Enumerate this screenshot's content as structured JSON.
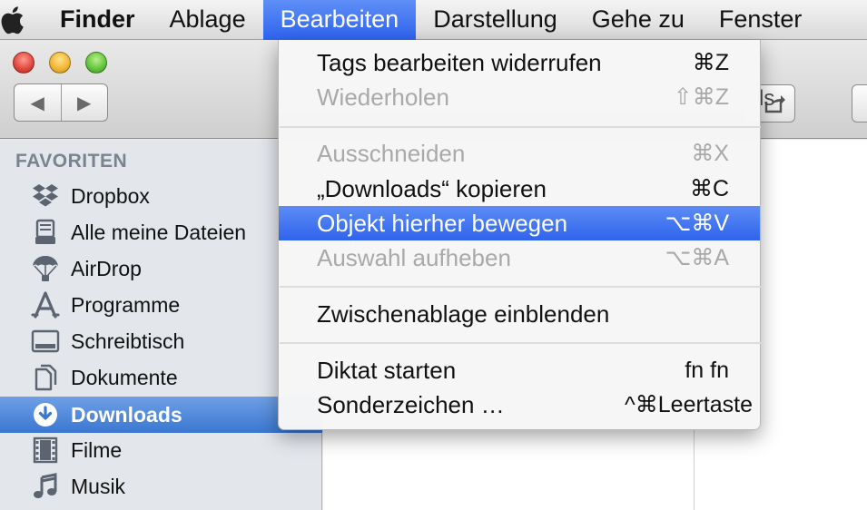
{
  "menubar": {
    "apple_icon": "apple-logo-icon",
    "items": [
      "Finder",
      "Ablage",
      "Bearbeiten",
      "Darstellung",
      "Gehe zu",
      "Fenster"
    ]
  },
  "window": {
    "title_fragment": "ls",
    "nav_back_icon": "◀",
    "nav_forward_icon": "▶"
  },
  "sidebar": {
    "heading": "FAVORITEN",
    "items": [
      {
        "label": "Dropbox",
        "icon": "dropbox-icon"
      },
      {
        "label": "Alle meine Dateien",
        "icon": "all-files-icon"
      },
      {
        "label": "AirDrop",
        "icon": "airdrop-icon"
      },
      {
        "label": "Programme",
        "icon": "applications-icon"
      },
      {
        "label": "Schreibtisch",
        "icon": "desktop-icon"
      },
      {
        "label": "Dokumente",
        "icon": "documents-icon"
      },
      {
        "label": "Downloads",
        "icon": "downloads-icon",
        "selected": true
      },
      {
        "label": "Filme",
        "icon": "movies-icon"
      },
      {
        "label": "Musik",
        "icon": "music-icon"
      }
    ]
  },
  "edit_menu": {
    "items": [
      {
        "label": "Tags bearbeiten widerrufen",
        "shortcut": "⌘Z",
        "enabled": true
      },
      {
        "label": "Wiederholen",
        "shortcut": "⇧⌘Z",
        "enabled": false
      },
      {
        "label": "Ausschneiden",
        "shortcut": "⌘X",
        "enabled": false
      },
      {
        "label": "„Downloads“ kopieren",
        "shortcut": "⌘C",
        "enabled": true
      },
      {
        "label": "Objekt hierher bewegen",
        "shortcut": "⌥⌘V",
        "enabled": true,
        "highlighted": true
      },
      {
        "label": "Auswahl aufheben",
        "shortcut": "⌥⌘A",
        "enabled": false
      },
      {
        "label": "Zwischenablage einblenden",
        "shortcut": "",
        "enabled": true
      },
      {
        "label": "Diktat starten",
        "shortcut": "fn fn",
        "enabled": true
      },
      {
        "label": "Sonderzeichen …",
        "shortcut": "^⌘Leertaste",
        "enabled": true
      }
    ]
  },
  "colors": {
    "menu_highlight": "#2f64ec",
    "sidebar_selected": "#3a77d0",
    "disabled_text": "#a9a9a9"
  }
}
